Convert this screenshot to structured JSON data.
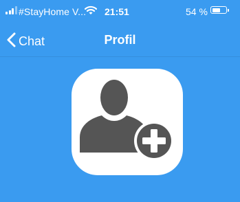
{
  "status_bar": {
    "carrier": "#StayHome V...",
    "time": "21:51",
    "battery_pct": "54 %",
    "battery_level": 0.54,
    "icons": [
      "signal-icon",
      "wifi-icon",
      "battery-icon"
    ]
  },
  "navbar": {
    "back_label": "Chat",
    "title": "Profil",
    "back_icon": "chevron-left-icon"
  },
  "avatar": {
    "icon": "add-user-icon"
  },
  "colors": {
    "background": "#3a9bf0",
    "tile": "#ffffff",
    "icon": "#555555"
  }
}
